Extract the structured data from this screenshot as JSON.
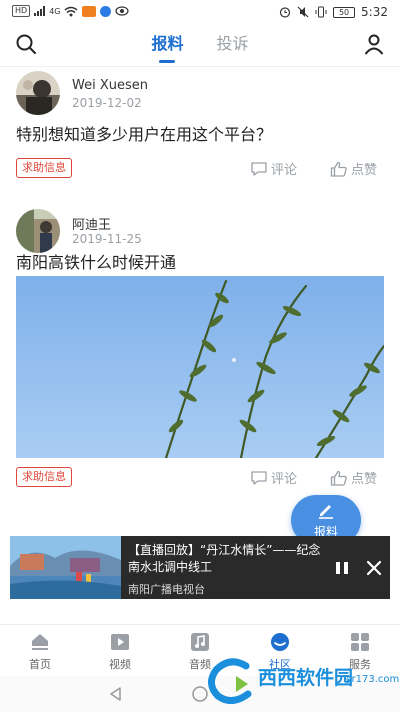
{
  "status_bar": {
    "left_chips": [
      "HD",
      "4G",
      "HD"
    ],
    "battery": "50",
    "time": "5:32"
  },
  "header": {
    "tabs": [
      {
        "label": "报料",
        "active": true
      },
      {
        "label": "投诉",
        "active": false
      }
    ],
    "icons": [
      "search-icon",
      "user-profile-icon"
    ]
  },
  "posts": [
    {
      "author": "Wei Xuesen",
      "date": "2019-12-02",
      "text": "特别想知道多少用户在用这个平台？",
      "tag": "求助信息",
      "comment_label": "评论",
      "like_label": "点赞"
    },
    {
      "author": "阿迪王",
      "date": "2019-11-25",
      "text": "南阳高铁什么时候开通",
      "tag": "求助信息",
      "comment_label": "评论",
      "like_label": "点赞"
    }
  ],
  "fab": {
    "label": "报料"
  },
  "player": {
    "title": "【直播回放】“丹江水情长”——纪念南水北调中线工",
    "source": "南阳广播电视台"
  },
  "bottom_nav": [
    {
      "label": "首页",
      "icon": "home-icon",
      "active": false
    },
    {
      "label": "视频",
      "icon": "video-icon",
      "active": false
    },
    {
      "label": "音频",
      "icon": "audio-icon",
      "active": false
    },
    {
      "label": "社区",
      "icon": "community-icon",
      "active": true
    },
    {
      "label": "服务",
      "icon": "services-icon",
      "active": false
    }
  ],
  "watermark": {
    "text": "西西软件园",
    "sub": "cr173.com"
  },
  "colors": {
    "accent": "#1f6fd1",
    "tag_red": "#e0463b",
    "fab": "#4a90e2"
  }
}
